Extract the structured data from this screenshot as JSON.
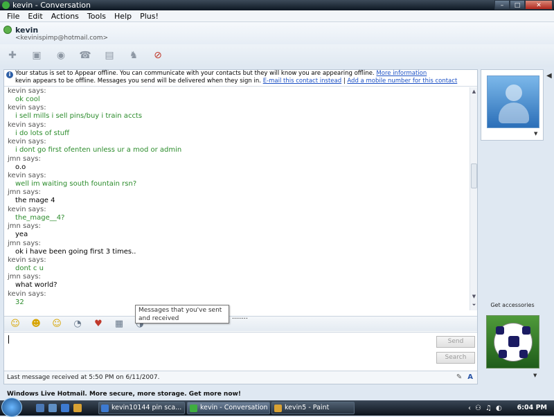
{
  "window": {
    "title": "kevin - Conversation",
    "controls": {
      "minimize": "–",
      "maximize": "□",
      "close": "✕"
    }
  },
  "menu": [
    "File",
    "Edit",
    "Actions",
    "Tools",
    "Help",
    "Plus!"
  ],
  "contact": {
    "name": "kevin",
    "email": "<kevinispimp@hotmail.com>"
  },
  "toolbar": {
    "icons": [
      "invite-icon",
      "share-files-icon",
      "webcam-icon",
      "call-icon",
      "activities-icon",
      "games-icon",
      "block-icon"
    ]
  },
  "infobar": {
    "line1": "Your status is set to Appear offline. You can communicate with your contacts but they will know you are appearing offline.",
    "more_info": "More information",
    "line2": "kevin appears to be offline. Messages you send will be delivered when they sign in.",
    "email_link": "E-mail this contact instead",
    "separator": "|",
    "mobile_link": "Add a mobile number for this contact"
  },
  "messages": [
    {
      "sender": "kevin says:",
      "text": "ok cool",
      "who": "kevin"
    },
    {
      "sender": "kevin says:",
      "text": "i sell mills i sell pins/buy i train accts",
      "who": "kevin"
    },
    {
      "sender": "kevin says:",
      "text": "i do lots of stuff",
      "who": "kevin"
    },
    {
      "sender": "kevin says:",
      "text": "i dont go first ofenten unless ur a mod or admin",
      "who": "kevin"
    },
    {
      "sender": "jmn says:",
      "text": "o.o",
      "who": "jmn"
    },
    {
      "sender": "kevin says:",
      "text": "well im waiting south fountain rsn?",
      "who": "kevin"
    },
    {
      "sender": "jmn says:",
      "text": "the mage  4",
      "who": "jmn"
    },
    {
      "sender": "kevin says:",
      "text": "the_mage__4?",
      "who": "kevin"
    },
    {
      "sender": "jmn says:",
      "text": "yea",
      "who": "jmn"
    },
    {
      "sender": "jmn says:",
      "text": "ok i have been going first 3 times..",
      "who": "jmn"
    },
    {
      "sender": "kevin says:",
      "text": "dont c u",
      "who": "kevin"
    },
    {
      "sender": "jmn says:",
      "text": "what world?",
      "who": "jmn"
    },
    {
      "sender": "kevin says:",
      "text": "32",
      "who": "kevin"
    }
  ],
  "tooltip": {
    "text": "Messages that you've sent and received"
  },
  "dots": "........",
  "compose": {
    "send_label": "Send",
    "search_label": "Search",
    "emoticons": [
      "☺",
      "☻",
      "☺",
      "◔",
      "♥",
      "▦",
      "◑"
    ]
  },
  "status_line": {
    "text": "Last message received at 5:50 PM on 6/11/2007.",
    "pen": "✎",
    "font": "A"
  },
  "right_pane": {
    "accessories_label": "Get accessories",
    "dropdown": "▼",
    "collapse": "◀"
  },
  "ad": {
    "text": "Windows Live Hotmail. More secure, more storage. Get more now!"
  },
  "taskbar": {
    "tasks": [
      {
        "label": "kevin10144 pin sca...",
        "active": false,
        "color": "#3d7ad1"
      },
      {
        "label": "kevin - Conversation",
        "active": true,
        "color": "#3fae3f"
      },
      {
        "label": "kevin5 - Paint",
        "active": false,
        "color": "#d9a233"
      }
    ],
    "tray_icons": [
      "‹",
      "⚇",
      "♫",
      "◐"
    ],
    "clock": "6:04 PM"
  }
}
